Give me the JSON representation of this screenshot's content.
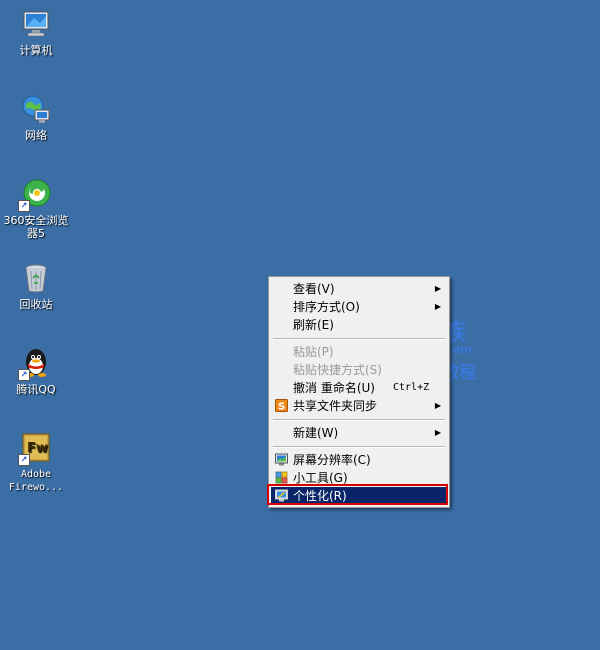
{
  "desktop": {
    "icons": [
      {
        "label": "计算机",
        "icon": "computer-icon"
      },
      {
        "label": "网络",
        "icon": "network-icon"
      },
      {
        "label": "360安全浏览器5",
        "icon": "browser-360-icon"
      },
      {
        "label": "回收站",
        "icon": "recycle-bin-icon"
      },
      {
        "label": "腾讯QQ",
        "icon": "qq-icon"
      },
      {
        "label_line1": "Adobe",
        "label_line2": "Firewo...",
        "icon": "fireworks-icon"
      }
    ]
  },
  "context_menu": {
    "items": [
      {
        "label": "查看(V)",
        "submenu": true
      },
      {
        "label": "排序方式(O)",
        "submenu": true
      },
      {
        "label": "刷新(E)"
      },
      {
        "label": "粘贴(P)",
        "disabled": true
      },
      {
        "label": "粘贴快捷方式(S)",
        "disabled": true
      },
      {
        "label": "撤消 重命名(U)",
        "shortcut": "Ctrl+Z"
      },
      {
        "label": "共享文件夹同步",
        "submenu": true
      },
      {
        "label": "新建(W)",
        "submenu": true
      },
      {
        "label": "屏幕分辨率(C)"
      },
      {
        "label": "小工具(G)"
      },
      {
        "label": "个性化(R)",
        "selected": true
      }
    ],
    "arrow": "▶"
  },
  "watermark": {
    "brand": "办公族",
    "domain": "Officezu.com",
    "tagline": "Word教程"
  },
  "colors": {
    "desktop": "#3a6ea5",
    "menu_bg": "#f0f0f0",
    "selection": "#0a246a",
    "highlight_box": "#d40000"
  }
}
